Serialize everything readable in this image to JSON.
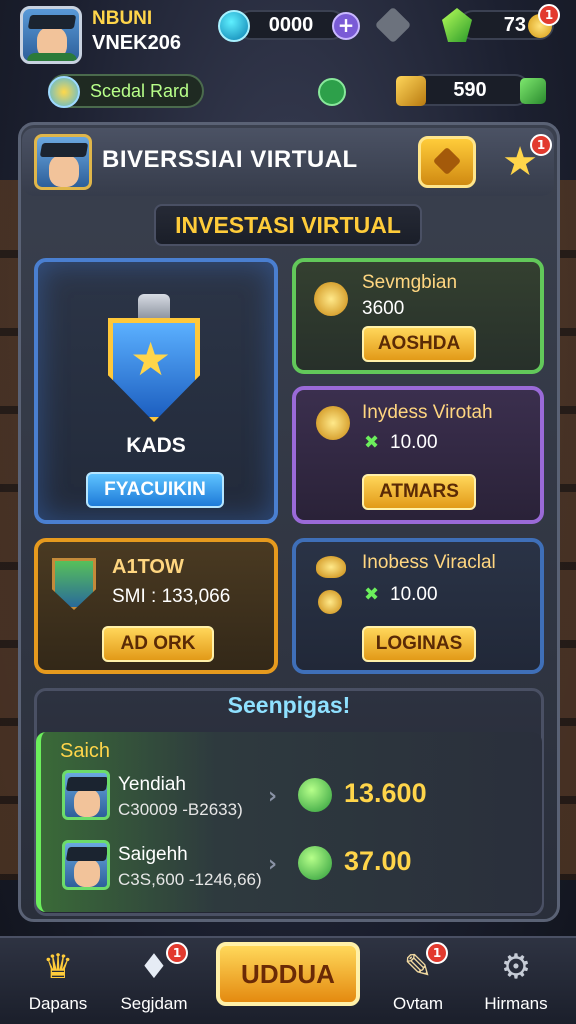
{
  "player": {
    "name": "NBUNI",
    "id": "VNEK206"
  },
  "currencies": {
    "teal_value": "0000",
    "gem_value": "73",
    "gem_badge": "1",
    "cube_value": "590"
  },
  "special_card": {
    "label": "Scedal Rard"
  },
  "header": {
    "title": "BIVERSSIAI VIRTUAL",
    "star_badge": "1"
  },
  "section_title": "INVESTASI VIRTUAL",
  "cards": {
    "main": {
      "title": "KADS",
      "button": "FYACUIKIN"
    },
    "green": {
      "title": "Sevmgbian",
      "value": "3600",
      "button": "AOSHDA"
    },
    "purple": {
      "title": "Inydess Virotah",
      "value": "10.00",
      "button": "ATMARS"
    },
    "orange": {
      "title": "A1TOW",
      "value": "SMI : 133,066",
      "button": "AD ORK"
    },
    "darkblue": {
      "title": "Inobess Viraclal",
      "value": "10.00",
      "button": "LOGINAS"
    }
  },
  "leaderboard": {
    "title": "Seenpigas!",
    "label": "Saich",
    "rows": [
      {
        "name": "Yendiah",
        "sub": "C30009 -B2633)",
        "score": "13.600"
      },
      {
        "name": "Saigehh",
        "sub": "C3S,600 -1246,66)",
        "score": "37.00"
      }
    ]
  },
  "nav": {
    "items": [
      {
        "label": "Dapans"
      },
      {
        "label": "Segjdam",
        "badge": "1"
      },
      {
        "label": "Ovtam",
        "badge": "1"
      },
      {
        "label": "Hirmans"
      }
    ],
    "main_button": "UDDUA"
  }
}
